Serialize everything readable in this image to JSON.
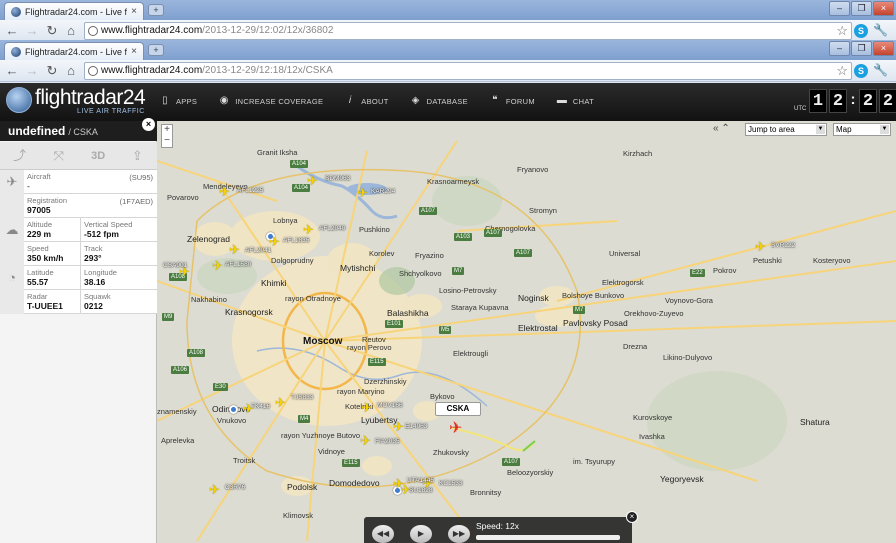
{
  "browser": {
    "window1": {
      "tab_title": "Flightradar24.com - Live fli…",
      "url_host": "www.flightradar24.com",
      "url_path": "/2013-12-29/12:02/12x/36802"
    },
    "window2": {
      "tab_title": "Flightradar24.com - Live fli…",
      "url_host": "www.flightradar24.com",
      "url_path": "/2013-12-29/12:18/12x/CSKA"
    }
  },
  "header": {
    "logo": "flightradar24",
    "logo_sub": "LIVE AIR TRAFFIC",
    "menu": [
      "APPS",
      "INCREASE COVERAGE",
      "ABOUT",
      "DATABASE",
      "FORUM",
      "CHAT"
    ],
    "utc_label": "UTC",
    "clock": [
      "1",
      "2",
      "2",
      "2"
    ]
  },
  "panel": {
    "callsign": "undefined",
    "flight": "/ CSKA",
    "tool_3d": "3D",
    "aircraft_label": "Aircraft",
    "aircraft_code": "(SU95)",
    "aircraft_value": "-",
    "registration_label": "Registration",
    "registration_code": "(1F7AED)",
    "registration_value": "97005",
    "altitude_label": "Altitude",
    "altitude_value": "229 m",
    "vspeed_label": "Vertical Speed",
    "vspeed_value": "-512 fpm",
    "speed_label": "Speed",
    "speed_value": "350 km/h",
    "track_label": "Track",
    "track_value": "293°",
    "lat_label": "Latitude",
    "lat_value": "55.57",
    "lon_label": "Longitude",
    "lon_value": "38.16",
    "radar_label": "Radar",
    "radar_value": "T-UUEE1",
    "squawk_label": "Squawk",
    "squawk_value": "0212"
  },
  "map": {
    "jump_to": "Jump to area",
    "map_type": "Map",
    "selected_label": "CSKA",
    "speed_text": "Speed: 12x",
    "places": {
      "moscow": "Moscow",
      "balashikha": "Balashikha",
      "mytishchi": "Mytishchi",
      "khimki": "Khimki",
      "zelenograd": "Zelenograd",
      "lobnya": "Lobnya",
      "dolgoprudny": "Dolgoprudny",
      "pushkino": "Pushkino",
      "krasnoarmeysk": "Krasnoarmeysk",
      "fryazino": "Fryazino",
      "shchyolkovo": "Shchyolkovo",
      "noginsk": "Noginsk",
      "elektrostal": "Elektrostal",
      "elektrogorsk": "Elektrogorsk",
      "pavlovsky_posad": "Pavlovsky\nPosad",
      "orekhovo": "Orekhovo-Zuyevo",
      "pokrov": "Pokrov",
      "petushki": "Petushki",
      "kosteryovo": "Kosteryovo",
      "krasnogorsk": "Krasnogorsk",
      "odintsovo": "Odintsovo",
      "lyubertsy": "Lyubertsy",
      "podolsk": "Podolsk",
      "domodedovo": "Domodedovo",
      "bronnitsy": "Bronnitsy",
      "likino": "Likino-Dulyovo",
      "kurovskoye": "Kurovskoye",
      "shatura": "Shatura",
      "yegoryevsk": "Yegoryevsk",
      "zhukovsky": "Zhukovsky",
      "troitsk": "Troitsk",
      "vidnoye": "Vidnoye",
      "klimovsk": "Klimovsk",
      "chernogolovka": "Chernogolovka",
      "granit": "Granit Iksha",
      "kirzhach": "Kirzhach",
      "fryanovo": "Fryanovo",
      "stromyn": "Stromyn",
      "mendeleyevo": "Mendeleyevo",
      "povarovo": "Povarovo",
      "nakhabino": "Nakhabino",
      "aprelevka": "Aprelevka",
      "znamenskiy": "znamenskiy",
      "staraya_kupavna": "Staraya\nKupavna",
      "losino": "Losino-Petrovsky",
      "elektrougli": "Elektrougli",
      "bykovo": "Bykovo",
      "belozyorsky": "Beloozyorskiy",
      "tsyurupy": "im. Tsyurupy",
      "dzerzhinskiy": "Dzerzhinskiy",
      "kotelniki": "Kotelniki",
      "reutov": "Reutov",
      "korolev": "Korolev",
      "vnukovo": "Vnukovo",
      "yuzhnoye": "rayon Yuzhnoye Butovo",
      "otradnoye": "rayon Otradnoye",
      "maryino": "rayon Maryino",
      "perovo": "rayon Perovo",
      "universal": "Universal",
      "voynovo": "Voynovo-Gora",
      "ivashka": "Ivashka",
      "drezna": "Drezna",
      "bunkovo": "Bolshoye\nBunkovo",
      "chekhov": "Chekhov"
    },
    "flights": [
      {
        "label": "AFL1225"
      },
      {
        "label": "SDM063"
      },
      {
        "label": "KAR294"
      },
      {
        "label": "AFL2040"
      },
      {
        "label": "AFL1835"
      },
      {
        "label": "AFL2041"
      },
      {
        "label": "AFL1580"
      },
      {
        "label": "CSA901"
      },
      {
        "label": "SVR222"
      },
      {
        "label": "TK416"
      },
      {
        "label": "TJS833"
      },
      {
        "label": "MOV166"
      },
      {
        "label": "E14063"
      },
      {
        "label": "FIA2035"
      },
      {
        "label": "KC1533"
      },
      {
        "label": "SU1828"
      },
      {
        "label": "C3R76"
      },
      {
        "label": "UTA1445"
      }
    ],
    "roads": [
      "A104",
      "A104",
      "A107",
      "A107",
      "A107",
      "A103",
      "M7",
      "M7",
      "M5",
      "E22",
      "E101",
      "E115",
      "A108",
      "A108",
      "M4",
      "A106",
      "A107",
      "E30",
      "M9",
      "E115"
    ]
  }
}
